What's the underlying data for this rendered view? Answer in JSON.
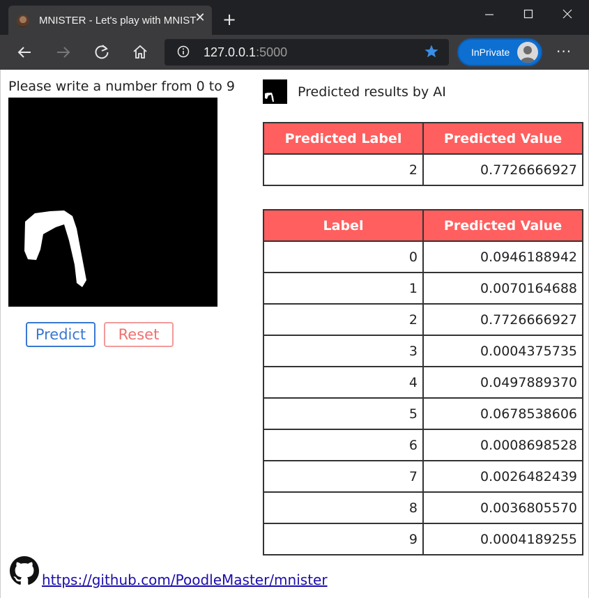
{
  "browser": {
    "tab_title": "MNISTER - Let's play with MNIST",
    "address_host": "127.0.0.1",
    "address_port": ":5000",
    "inprivate_label": "InPrivate"
  },
  "page": {
    "prompt": "Please write a number from 0 to 9",
    "predict_label": "Predict",
    "reset_label": "Reset",
    "results_title": "Predicted results by AI",
    "summary_table": {
      "headers": [
        "Predicted Label",
        "Predicted Value"
      ],
      "row": [
        "2",
        "0.7726666927"
      ]
    },
    "detail_table": {
      "headers": [
        "Label",
        "Predicted Value"
      ],
      "rows": [
        [
          "0",
          "0.0946188942"
        ],
        [
          "1",
          "0.0070164688"
        ],
        [
          "2",
          "0.7726666927"
        ],
        [
          "3",
          "0.0004375735"
        ],
        [
          "4",
          "0.0497889370"
        ],
        [
          "5",
          "0.0678538606"
        ],
        [
          "6",
          "0.0008698528"
        ],
        [
          "7",
          "0.0026482439"
        ],
        [
          "8",
          "0.0036805570"
        ],
        [
          "9",
          "0.0004189255"
        ]
      ]
    },
    "github_link": " https://github.com/PoodleMaster/mnister"
  },
  "colors": {
    "header_red": "#ff5f5f",
    "predict_blue": "#3a78d0",
    "reset_red": "#f07070",
    "link": "#1a0dab"
  }
}
